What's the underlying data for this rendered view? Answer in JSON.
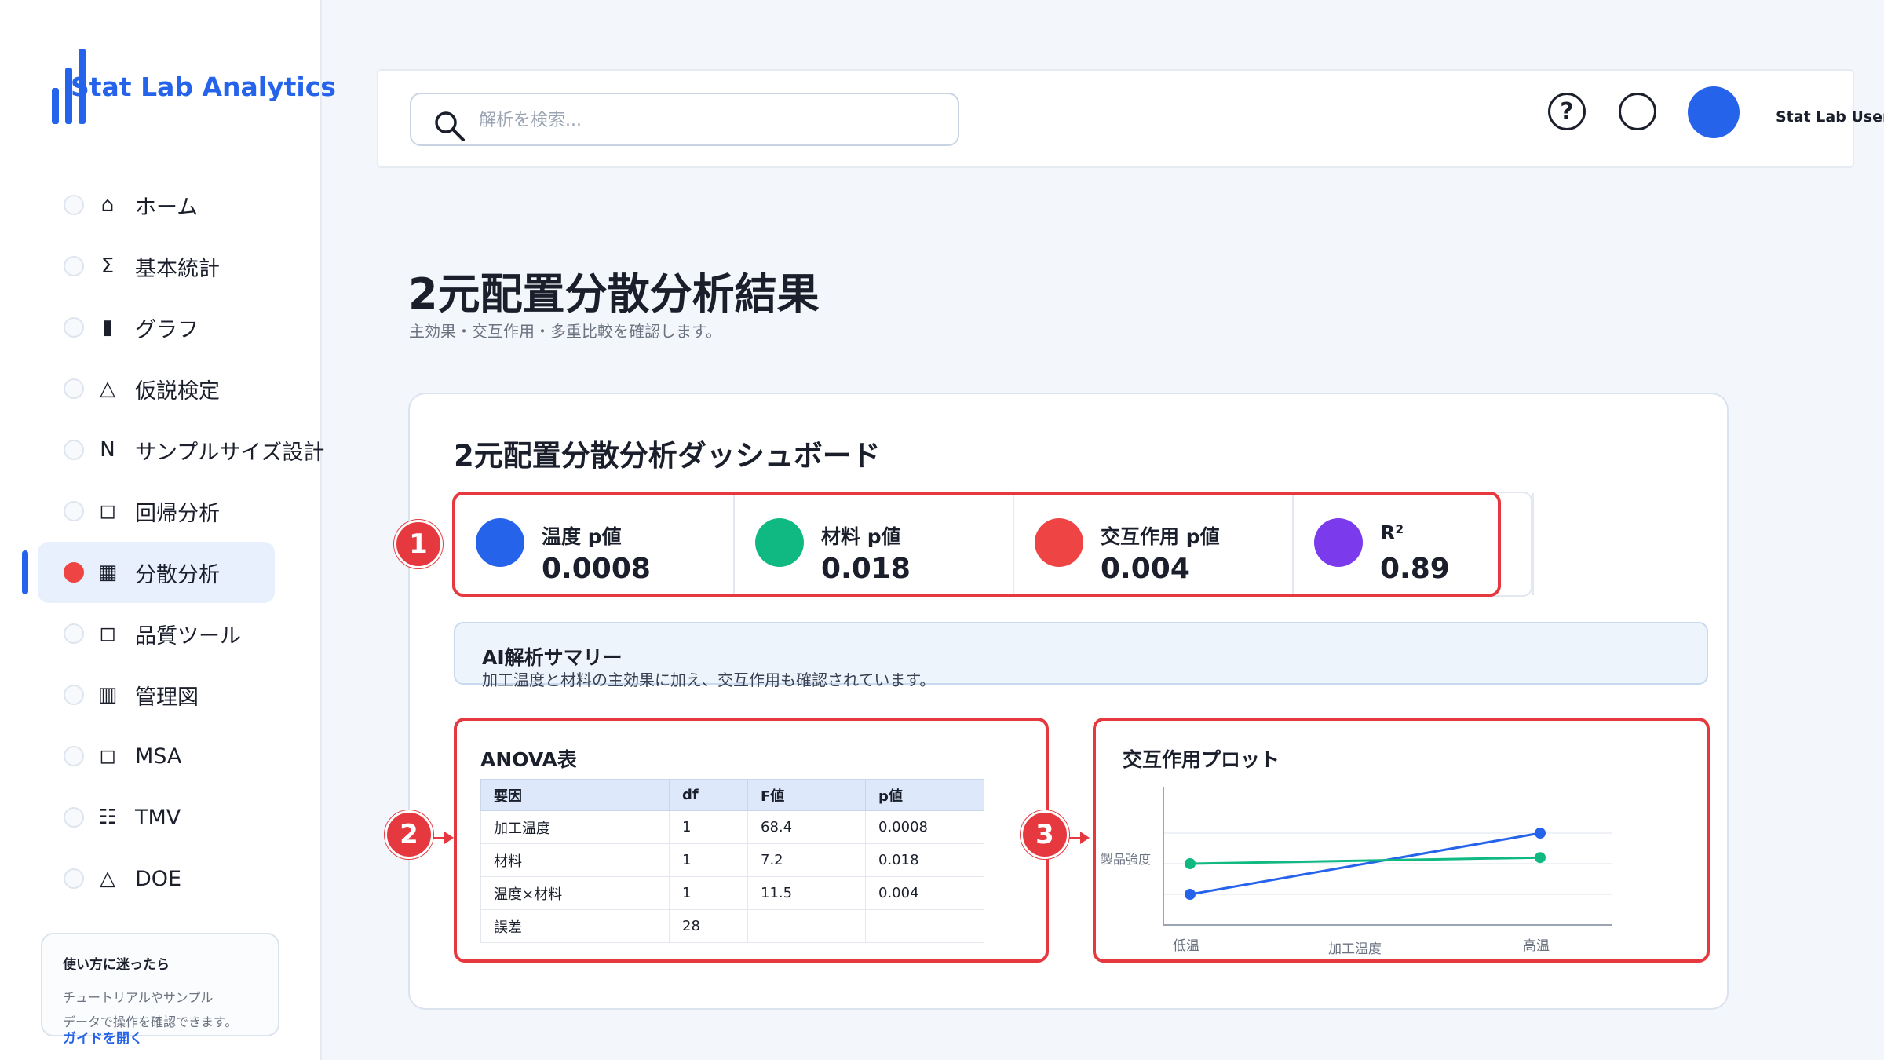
{
  "app": {
    "name": "Stat Lab Analytics"
  },
  "sidebar": {
    "items": [
      {
        "glyph": "⌂",
        "label": "ホーム",
        "active": false
      },
      {
        "glyph": "Σ",
        "label": "基本統計",
        "active": false
      },
      {
        "glyph": "▮",
        "label": "グラフ",
        "active": false
      },
      {
        "glyph": "△",
        "label": "仮説検定",
        "active": false
      },
      {
        "glyph": "N",
        "label": "サンプルサイズ設計",
        "active": false
      },
      {
        "glyph": "◻",
        "label": "回帰分析",
        "active": false
      },
      {
        "glyph": "▦",
        "label": "分散分析",
        "active": true
      },
      {
        "glyph": "◻",
        "label": "品質ツール",
        "active": false
      },
      {
        "glyph": "▥",
        "label": "管理図",
        "active": false
      },
      {
        "glyph": "◻",
        "label": "MSA",
        "active": false
      },
      {
        "glyph": "☷",
        "label": "TMV",
        "active": false
      },
      {
        "glyph": "△",
        "label": "DOE",
        "active": false
      }
    ],
    "help": {
      "title": "使い方に迷ったら",
      "text_line1": "チュートリアルやサンプル",
      "text_line2": "データで操作を確認できます。",
      "link": "ガイドを開く"
    }
  },
  "topbar": {
    "search_placeholder": "解析を検索...",
    "help_glyph": "?",
    "user_name": "Stat Lab User"
  },
  "page": {
    "title": "2元配置分散分析結果",
    "subtitle": "主効果・交互作用・多重比較を確認します。"
  },
  "dashboard": {
    "title": "2元配置分散分析ダッシュボード",
    "kpis": [
      {
        "label": "温度 p値",
        "value": "0.0008",
        "color": "#2563eb"
      },
      {
        "label": "材料 p値",
        "value": "0.018",
        "color": "#10b981"
      },
      {
        "label": "交互作用 p値",
        "value": "0.004",
        "color": "#ef4444"
      },
      {
        "label": "R²",
        "value": "0.89",
        "color": "#7c3aed"
      }
    ],
    "summary": {
      "title": "AI解析サマリー",
      "text": "加工温度と材料の主効果に加え、交互作用も確認されています。"
    },
    "anova": {
      "title": "ANOVA表",
      "columns": [
        "要因",
        "df",
        "F値",
        "p値"
      ],
      "rows": [
        [
          "加工温度",
          "1",
          "68.4",
          "0.0008"
        ],
        [
          "材料",
          "1",
          "7.2",
          "0.018"
        ],
        [
          "温度×材料",
          "1",
          "11.5",
          "0.004"
        ],
        [
          "誤差",
          "28",
          "",
          ""
        ]
      ]
    },
    "callouts": [
      "1",
      "2",
      "3"
    ]
  },
  "chart_data": {
    "type": "line",
    "title": "交互作用プロット",
    "xlabel": "加工温度",
    "ylabel": "製品強度",
    "categories": [
      "低温",
      "高温"
    ],
    "series": [
      {
        "values": [
          1.0,
          3.0
        ],
        "color": "#2563eb"
      },
      {
        "values": [
          2.0,
          2.2
        ],
        "color": "#10b981"
      }
    ],
    "ylim": [
      0,
      4
    ],
    "grid": true
  },
  "colors": {
    "accent": "#2563eb",
    "highlight": "#e5393f"
  }
}
